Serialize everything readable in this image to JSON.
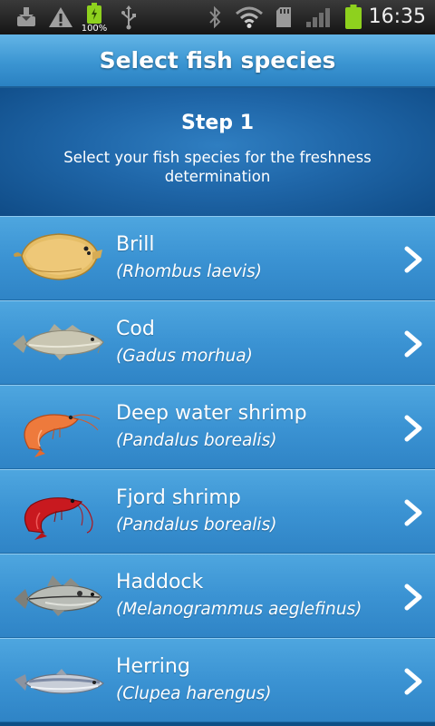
{
  "status_bar": {
    "battery_label": "100%",
    "time": "16:35",
    "icons": [
      "download-icon",
      "warning-icon",
      "battery-icon",
      "usb-icon",
      "bluetooth-icon",
      "wifi-icon",
      "sd-card-icon",
      "signal-icon",
      "battery-full-icon"
    ]
  },
  "title": "Select fish species",
  "intro": {
    "step": "Step 1",
    "description": "Select your fish species for the freshness determination"
  },
  "species": [
    {
      "name": "Brill",
      "latin": "(Rhombus laevis)",
      "icon": "brill-icon"
    },
    {
      "name": "Cod",
      "latin": "(Gadus morhua)",
      "icon": "cod-icon"
    },
    {
      "name": "Deep water shrimp",
      "latin": "(Pandalus borealis)",
      "icon": "deep-water-shrimp-icon"
    },
    {
      "name": "Fjord shrimp",
      "latin": "(Pandalus borealis)",
      "icon": "fjord-shrimp-icon"
    },
    {
      "name": "Haddock",
      "latin": "(Melanogrammus aeglefinus)",
      "icon": "haddock-icon"
    },
    {
      "name": "Herring",
      "latin": "(Clupea harengus)",
      "icon": "herring-icon"
    }
  ],
  "colors": {
    "title_bar": "#3b95d2",
    "list_row": "#3b93d3",
    "intro_panel": "#1f66a8",
    "battery_green": "#8ed11e"
  }
}
